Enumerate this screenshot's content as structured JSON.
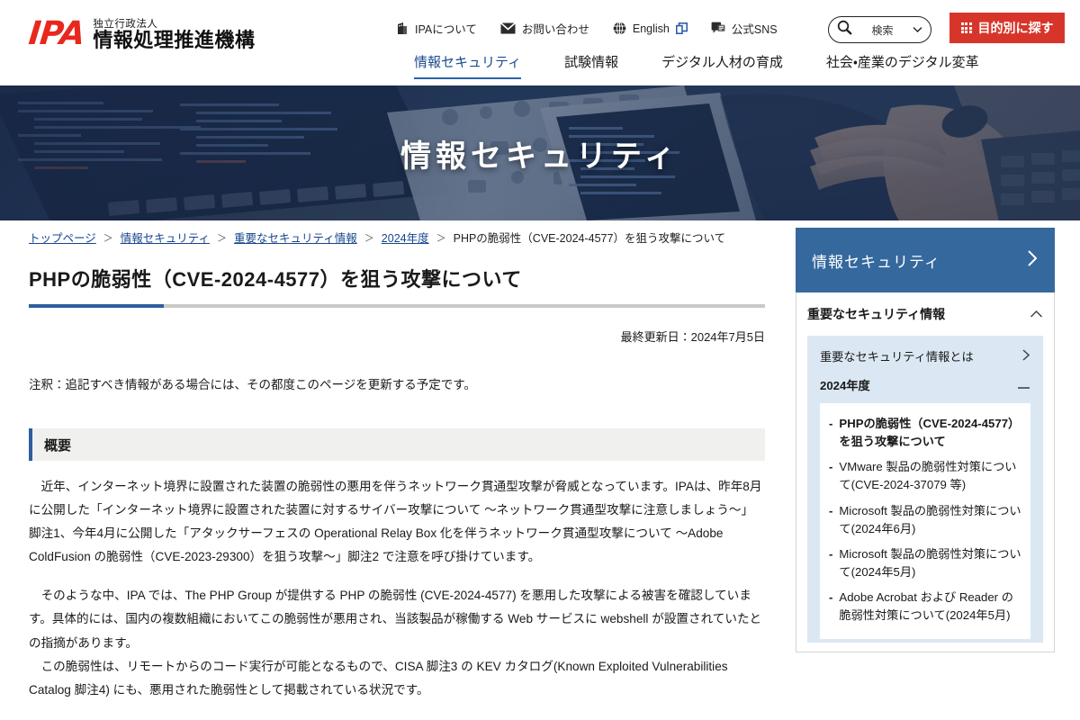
{
  "header": {
    "logo": {
      "mark": "IPA",
      "sub": "独立行政法人",
      "main": "情報処理推進機構"
    },
    "utility": [
      {
        "label": "IPAについて",
        "icon": "building-icon"
      },
      {
        "label": "お問い合わせ",
        "icon": "mail-icon"
      },
      {
        "label": "English",
        "icon": "globe-icon",
        "external": true
      },
      {
        "label": "公式SNS",
        "icon": "sns-icon"
      }
    ],
    "search": {
      "placeholder": "検索",
      "icon": "search-icon",
      "chevron": "chevron-down-icon"
    },
    "purpose_button": {
      "label": "目的別に探す",
      "icon": "grid-icon",
      "color": "#d8352a"
    },
    "nav": [
      {
        "label": "情報セキュリティ",
        "active": true
      },
      {
        "label": "試験情報",
        "active": false
      },
      {
        "label": "デジタル人材の育成",
        "active": false
      },
      {
        "label": "社会・産業のデジタル変革",
        "active": false
      }
    ]
  },
  "hero": {
    "title": "情報セキュリティ"
  },
  "breadcrumb": {
    "links": [
      "トップページ",
      "情報セキュリティ",
      "重要なセキュリティ情報",
      "2024年度"
    ],
    "separator": "＞",
    "current": "PHPの脆弱性（CVE-2024-4577）を狙う攻撃について"
  },
  "main": {
    "title": "PHPの脆弱性（CVE-2024-4577）を狙う攻撃について",
    "updated": "最終更新日：2024年7月5日",
    "note": "注釈：追記すべき情報がある場合には、その都度このページを更新する予定です。",
    "section_heading": "概要",
    "paragraphs": [
      "近年、インターネット境界に設置された装置の脆弱性の悪用を伴うネットワーク貫通型攻撃が脅威となっています。IPAは、昨年8月に公開した「インターネット境界に設置された装置に対するサイバー攻撃について ～ネットワーク貫通型攻撃に注意しましょう～」脚注1、今年4月に公開した「アタックサーフェスの Operational Relay Box 化を伴うネットワーク貫通型攻撃について ～Adobe ColdFusion の脆弱性（CVE-2023-29300）を狙う攻撃～」脚注2 で注意を呼び掛けています。",
      "そのような中、IPA では、The PHP Group が提供する PHP の脆弱性 (CVE-2024-4577) を悪用した攻撃による被害を確認しています。具体的には、国内の複数組織においてこの脆弱性が悪用され、当該製品が稼働する Web サービスに webshell が設置されていたとの指摘があります。",
      "この脆弱性は、リモートからのコード実行が可能となるもので、CISA 脚注3 の KEV カタログ(Known Exploited Vulnerabilities Catalog 脚注4) にも、悪用された脆弱性として掲載されている状況です。"
    ]
  },
  "sidebar": {
    "header": {
      "label": "情報セキュリティ",
      "icon": "chevron-right-icon",
      "color": "#35689d"
    },
    "accordion": {
      "label": "重要なセキュリティ情報",
      "icon": "chevron-up-icon"
    },
    "panel_links": [
      {
        "label": "重要なセキュリティ情報とは",
        "icon": "chevron-right-icon"
      }
    ],
    "year": {
      "label": "2024年度",
      "icon": "minus-icon"
    },
    "items": [
      {
        "label": "PHPの脆弱性（CVE-2024-4577）を狙う攻撃について",
        "current": true
      },
      {
        "label": "VMware 製品の脆弱性対策について(CVE-2024-37079 等)",
        "current": false
      },
      {
        "label": "Microsoft 製品の脆弱性対策について(2024年6月)",
        "current": false
      },
      {
        "label": "Microsoft 製品の脆弱性対策について(2024年5月)",
        "current": false
      },
      {
        "label": "Adobe Acrobat および Reader の脆弱性対策について(2024年5月)",
        "current": false
      }
    ]
  }
}
